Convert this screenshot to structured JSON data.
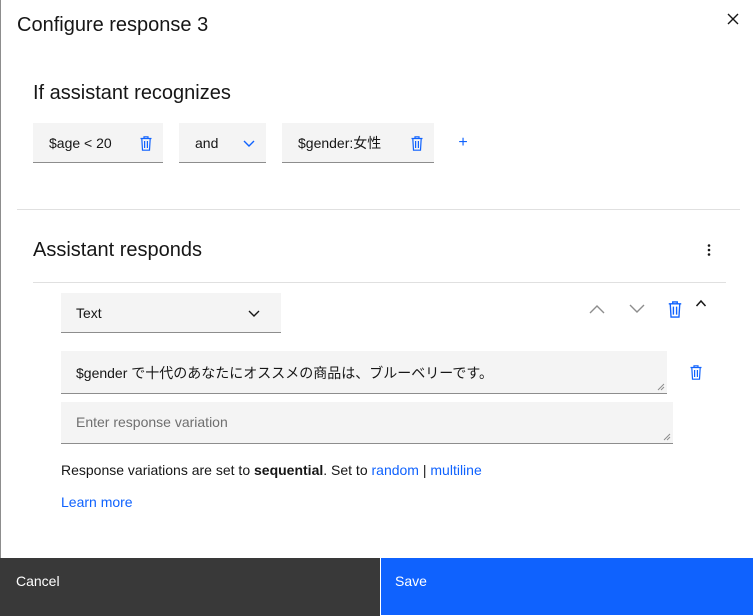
{
  "modal": {
    "title": "Configure response 3"
  },
  "conditions": {
    "heading": "If assistant recognizes",
    "first": "$age < 20",
    "operator": "and",
    "second": "$gender:女性",
    "add_symbol": "+"
  },
  "responds": {
    "heading": "Assistant responds",
    "type_value": "Text",
    "variation_1": "$gender で十代のあなたにオススメの商品は、ブルーベリーです。",
    "variation_placeholder": "Enter response variation",
    "info_prefix": "Response variations are set to ",
    "info_mode": "sequential",
    "info_middle": ". Set to ",
    "info_random": "random",
    "info_separator": " | ",
    "info_multiline": "multiline",
    "learn_more": "Learn more"
  },
  "footer": {
    "cancel_label": "Cancel",
    "save_label": "Save"
  },
  "colors": {
    "accent": "#0f62fe",
    "footer_dark": "#393939",
    "field_bg": "#f4f4f4"
  },
  "icons": [
    "close-icon",
    "trash-icon",
    "chevron-down-icon",
    "plus-icon",
    "overflow-menu-icon",
    "chevron-up-icon"
  ]
}
